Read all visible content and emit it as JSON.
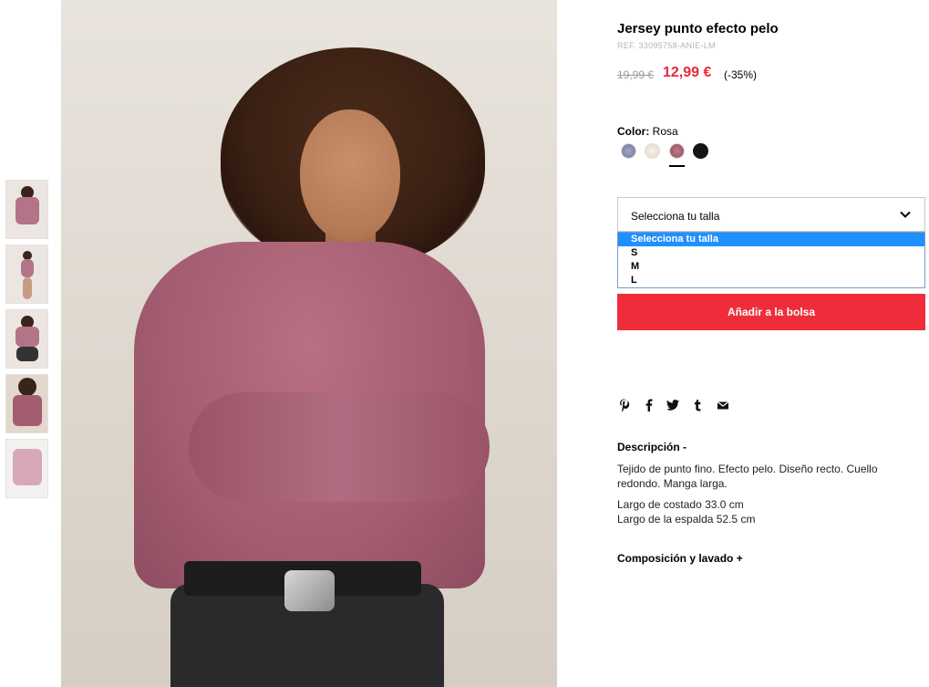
{
  "product": {
    "title": "Jersey punto efecto pelo",
    "ref": "REF. 33095758-ANIE-LM",
    "old_price": "19,99 €",
    "new_price": "12,99 €",
    "discount": "(-35%)"
  },
  "color": {
    "label": "Color:",
    "selected_name": "Rosa",
    "swatches": [
      {
        "name": "lavender",
        "color": "#8a8fb3"
      },
      {
        "name": "cream",
        "color": "#efe6d8"
      },
      {
        "name": "rosa",
        "color": "#a35c6a"
      },
      {
        "name": "black",
        "color": "#1a1a1a"
      }
    ]
  },
  "size": {
    "placeholder": "Selecciona tu talla",
    "options": [
      "Selecciona tu talla",
      "S",
      "M",
      "L"
    ]
  },
  "add_button": "Añadir a la bolsa",
  "social_icons": [
    "pinterest-icon",
    "facebook-icon",
    "twitter-icon",
    "tumblr-icon",
    "email-icon"
  ],
  "description": {
    "heading": "Descripción -",
    "text": "Tejido de punto fino. Efecto pelo. Diseño recto. Cuello redondo. Manga larga.",
    "dim1": "Largo de costado 33.0 cm",
    "dim2": "Largo de la espalda 52.5 cm"
  },
  "composition": {
    "heading": "Composición y lavado +"
  },
  "colors": {
    "price_red": "#e6293a",
    "button_red": "#ef2d3a",
    "dropdown_highlight": "#1e90ff"
  }
}
